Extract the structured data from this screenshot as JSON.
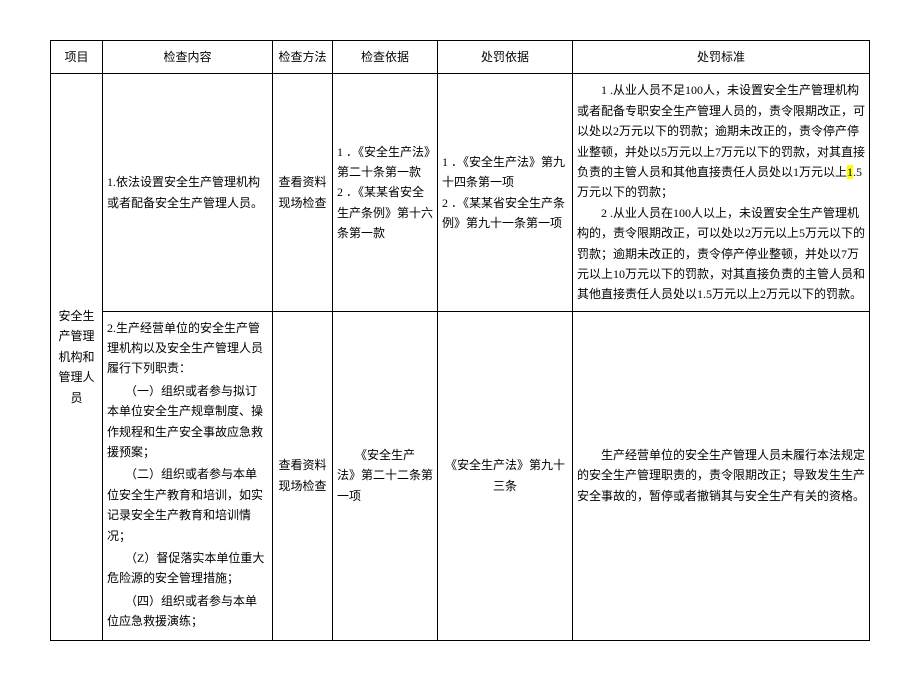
{
  "headers": {
    "project": "项目",
    "content": "检查内容",
    "method": "检查方法",
    "basis": "检查依据",
    "penaltyBasis": "处罚依据",
    "standard": "处罚标准"
  },
  "rows": [
    {
      "projectLabel": "安全生产管理机构和管理人员",
      "content": "1.依法设置安全生产管理机构或者配备安全生产管理人员。",
      "method": "查看资料现场检查",
      "basis": {
        "item1_num": "1",
        "item1_text": "．《安全生产法》第二十条第一款",
        "item2_num": "2",
        "item2_text": "．《某某省安全生产条例》第十六条第一款"
      },
      "penaltyBasis": {
        "item1_num": "1",
        "item1_text": "．《安全生产法》第九十四条第一项",
        "item2_num": "2",
        "item2_text": "．《某某省安全生产条例》第九十一条第一项"
      },
      "standard": {
        "para1_a": "　　1 .从业人员不足100人，未设置安全生产管理机构或者配备专职安全生产管理人员的，责令限期改正，可以处以2万元以下的罚款；逾期未改正的，责令停产停业整顿，并处以5万元以上7万元以下的罚款，对其直接负责的主管人员和其他直接责任人员处以1万元以上",
        "hl": "1",
        "para1_b": ".5万元以下的罚款；",
        "para2": "　　2 .从业人员在100人以上，未设置安全生产管理机构的，责令限期改正，可以处以2万元以上5万元以下的罚款；逾期未改正的，责令停产停业整顿，并处以7万元以上10万元以下的罚款，对其直接负责的主管人员和其他直接责任人员处以1.5万元以上2万元以下的罚款。"
      }
    },
    {
      "content_lines": {
        "l0": "2.生产经营单位的安全生产管理机构以及安全生产管理人员履行下列职责：",
        "l1": "　　（一）组织或者参与拟订本单位安全生产规章制度、操作规程和生产安全事故应急救援预案；",
        "l2": "　　（二）组织或者参与本单位安全生产教育和培训，如实记录安全生产教育和培训情况；",
        "l3": "　　（Z）督促落实本单位重大危险源的安全管理措施；",
        "l4": "　　（四）组织或者参与本单位应急救援演练；"
      },
      "method": "查看资料现场检查",
      "basis": "　　《安全生产法》第二十二条第一项",
      "penaltyBasis": "《安全生产法》第九十三条",
      "standard": "　　生产经营单位的安全生产管理人员未履行本法规定的安全生产管理职责的，责令限期改正；导致发生生产安全事故的，暂停或者撤销其与安全生产有关的资格。"
    }
  ]
}
